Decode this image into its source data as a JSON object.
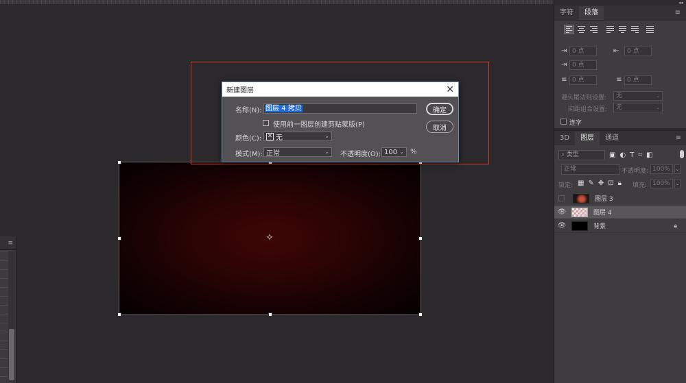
{
  "dialog": {
    "title": "新建图层",
    "name_label": "名称(N):",
    "name_value": "图层 4 拷贝",
    "clip_label": "使用前一图层创建剪贴蒙版(P)",
    "color_label": "颜色(C):",
    "color_value": "无",
    "mode_label": "模式(M):",
    "mode_value": "正常",
    "opacity_label": "不透明度(O):",
    "opacity_value": "100",
    "opacity_unit": "%",
    "ok_label": "确定",
    "cancel_label": "取消",
    "close_glyph": "✕"
  },
  "char_panel": {
    "tabs": [
      "字符",
      "段落"
    ],
    "menu_glyph": "≡",
    "indent_left": "0 点",
    "indent_right": "0 点",
    "indent_first": "0 点",
    "space_before": "0 点",
    "space_after": "0 点",
    "kinsoku_label": "避头尾法则设置:",
    "kinsoku_value": "无",
    "mojikumi_label": "间距组合设置:",
    "mojikumi_value": "无",
    "hyphenate_label": "连字"
  },
  "layers_panel": {
    "tabs": [
      "3D",
      "图层",
      "通道"
    ],
    "menu_glyph": "≡",
    "filter_kind": "类型",
    "blend_mode": "正常",
    "opacity_label": "不透明度:",
    "opacity_value": "100%",
    "lock_label": "锁定:",
    "fill_label": "填充:",
    "fill_value": "100%",
    "layers": [
      {
        "name": "图层 3",
        "visible": false,
        "selected": false
      },
      {
        "name": "图层 4",
        "visible": true,
        "selected": true
      },
      {
        "name": "背景",
        "visible": true,
        "selected": false,
        "locked": true
      }
    ]
  },
  "colors": {
    "accent_highlight": "#d4402a",
    "selection_blue": "#1f6bd1",
    "canvas_center": "#3d0605"
  }
}
